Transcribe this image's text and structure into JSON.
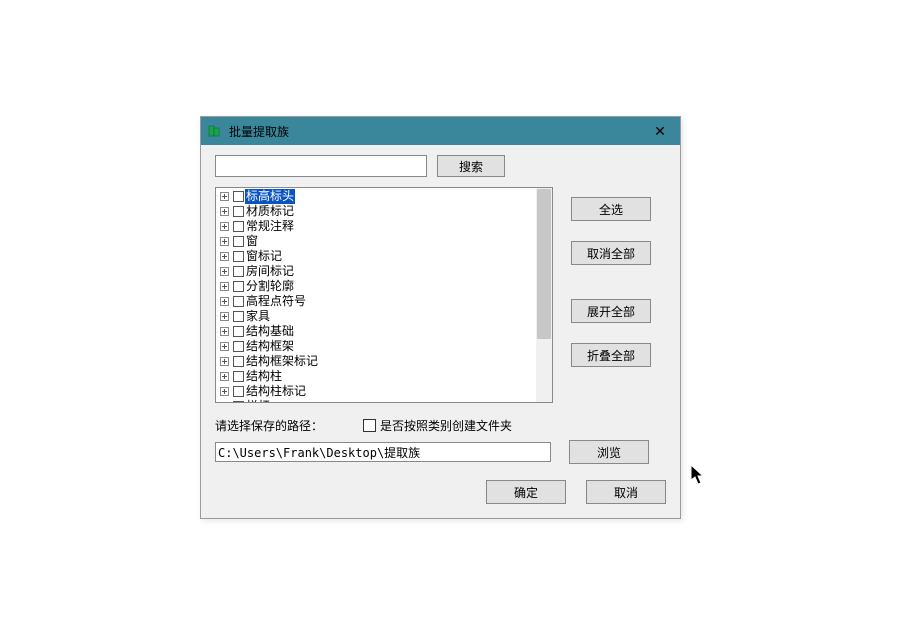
{
  "dialog": {
    "title": "批量提取族",
    "close_glyph": "✕"
  },
  "search": {
    "value": "",
    "button": "搜索"
  },
  "tree": {
    "items": [
      {
        "label": "标高标头",
        "selected": true
      },
      {
        "label": "材质标记"
      },
      {
        "label": "常规注释"
      },
      {
        "label": "窗"
      },
      {
        "label": "窗标记"
      },
      {
        "label": "房间标记"
      },
      {
        "label": "分割轮廓"
      },
      {
        "label": "高程点符号"
      },
      {
        "label": "家具"
      },
      {
        "label": "结构基础"
      },
      {
        "label": "结构框架"
      },
      {
        "label": "结构框架标记"
      },
      {
        "label": "结构柱"
      },
      {
        "label": "结构柱标记"
      },
      {
        "label": "栏杆"
      }
    ]
  },
  "side": {
    "select_all": "全选",
    "deselect_all": "取消全部",
    "expand_all": "展开全部",
    "collapse_all": "折叠全部"
  },
  "options": {
    "path_label": "请选择保存的路径：",
    "folder_by_category": "是否按照类别创建文件夹",
    "folder_checked": false
  },
  "path": {
    "value": "C:\\Users\\Frank\\Desktop\\提取族",
    "browse": "浏览"
  },
  "buttons": {
    "ok": "确定",
    "cancel": "取消"
  }
}
